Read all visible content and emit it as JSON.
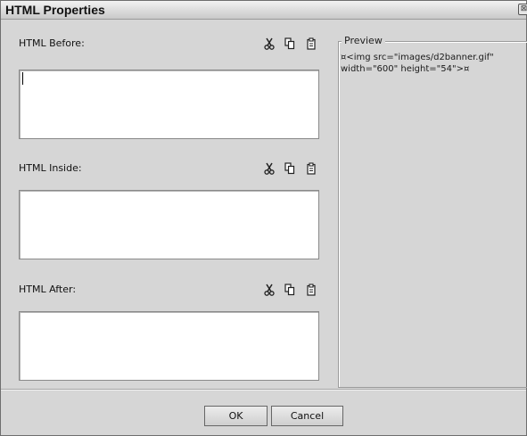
{
  "window": {
    "title": "HTML Properties",
    "close_glyph": "⊠"
  },
  "sections": [
    {
      "label": "HTML Before:",
      "value": ""
    },
    {
      "label": "HTML Inside:",
      "value": ""
    },
    {
      "label": "HTML After:",
      "value": ""
    }
  ],
  "tool_icons": [
    "cut-icon",
    "copy-icon",
    "paste-icon"
  ],
  "preview": {
    "legend": "Preview",
    "content": "¤<img src=\"images/d2banner.gif\" width=\"600\" height=\"54\">¤"
  },
  "buttons": {
    "ok": "OK",
    "cancel": "Cancel"
  },
  "colors": {
    "dialog_bg": "#d6d6d6",
    "field_bg": "#ffffff",
    "border": "#6e6e6e"
  }
}
